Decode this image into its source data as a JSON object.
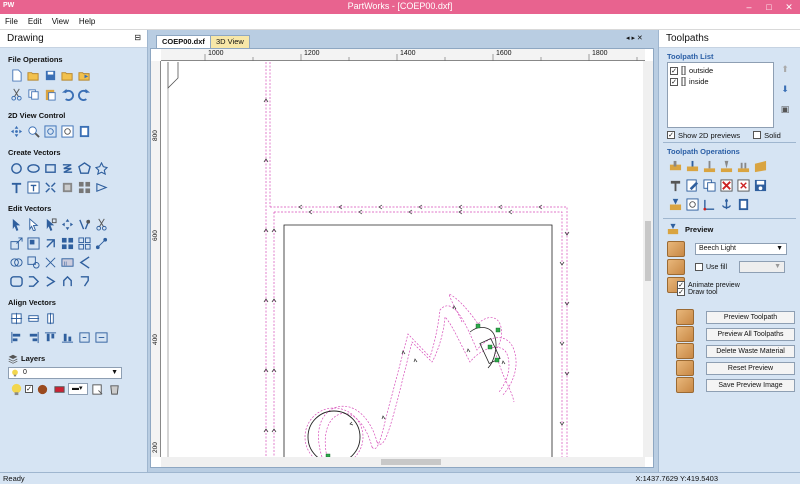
{
  "app": {
    "logo": "PW",
    "title": "PartWorks - [COEP00.dxf]",
    "minimize": "–",
    "maximize": "□",
    "close": "✕"
  },
  "menu": [
    "File",
    "Edit",
    "View",
    "Help"
  ],
  "left_panel": {
    "title": "Drawing",
    "pin": "⊟",
    "sections": {
      "file_ops": "File Operations",
      "view_ctrl": "2D View Control",
      "create_vectors": "Create Vectors",
      "edit_vectors": "Edit Vectors",
      "align_vectors": "Align Vectors",
      "layers": "Layers"
    },
    "layer_value": "0"
  },
  "tabs": {
    "active": "COEP00.dxf",
    "other": "3D View",
    "controls": "◂ ▸ ✕"
  },
  "rulers": {
    "h": [
      "1000",
      "1200",
      "1400",
      "1600",
      "1800"
    ],
    "v": [
      "800",
      "600",
      "400",
      "200"
    ]
  },
  "right_panel": {
    "title": "Toolpaths",
    "list_title": "Toolpath List",
    "toolpaths": [
      "outside",
      "inside"
    ],
    "show_previews": "Show 2D previews",
    "solid": "Solid",
    "ops_title": "Toolpath Operations",
    "preview_title": "Preview",
    "material": "Beech Light",
    "use_fill": "Use fill",
    "animate": "Animate preview",
    "draw_tool": "Draw tool",
    "buttons": [
      "Preview Toolpath",
      "Preview All Toolpaths",
      "Delete Waste Material",
      "Reset Preview",
      "Save Preview Image"
    ]
  },
  "status": {
    "left": "Ready",
    "coords": "X:1437.7629 Y:419.5403"
  },
  "colors": {
    "titlebar": "#e8638f",
    "panel": "#d6e4f3",
    "toolpath": "#d64bb8",
    "accent": "#2b5fa6"
  }
}
